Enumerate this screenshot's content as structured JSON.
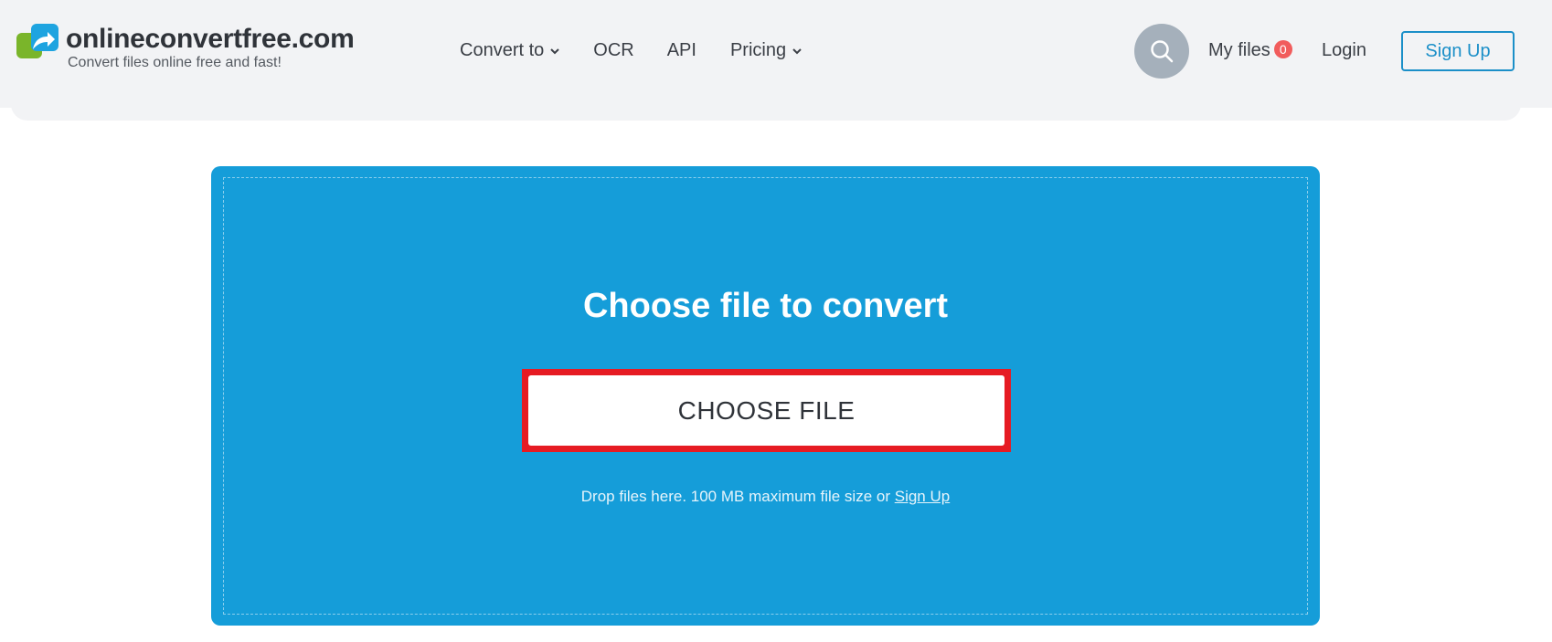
{
  "header": {
    "logo": {
      "name": "onlineconvertfree.com",
      "tagline": "Convert files online free and fast!"
    },
    "nav": [
      {
        "label": "Convert to",
        "has_dropdown": true
      },
      {
        "label": "OCR",
        "has_dropdown": false
      },
      {
        "label": "API",
        "has_dropdown": false
      },
      {
        "label": "Pricing",
        "has_dropdown": true
      }
    ],
    "search_icon": "search-icon",
    "my_files": {
      "label": "My files",
      "count": "0"
    },
    "login_label": "Login",
    "signup_label": "Sign Up"
  },
  "upload": {
    "title": "Choose file to convert",
    "button_label": "CHOOSE FILE",
    "note_text": "Drop files here. 100 MB maximum file size or ",
    "note_link": "Sign Up"
  },
  "colors": {
    "panel_blue": "#159dd9",
    "highlight_red": "#e61b23",
    "header_bg": "#f2f3f5",
    "signup_blue": "#1b8fc8",
    "badge_red": "#f15c5c"
  }
}
